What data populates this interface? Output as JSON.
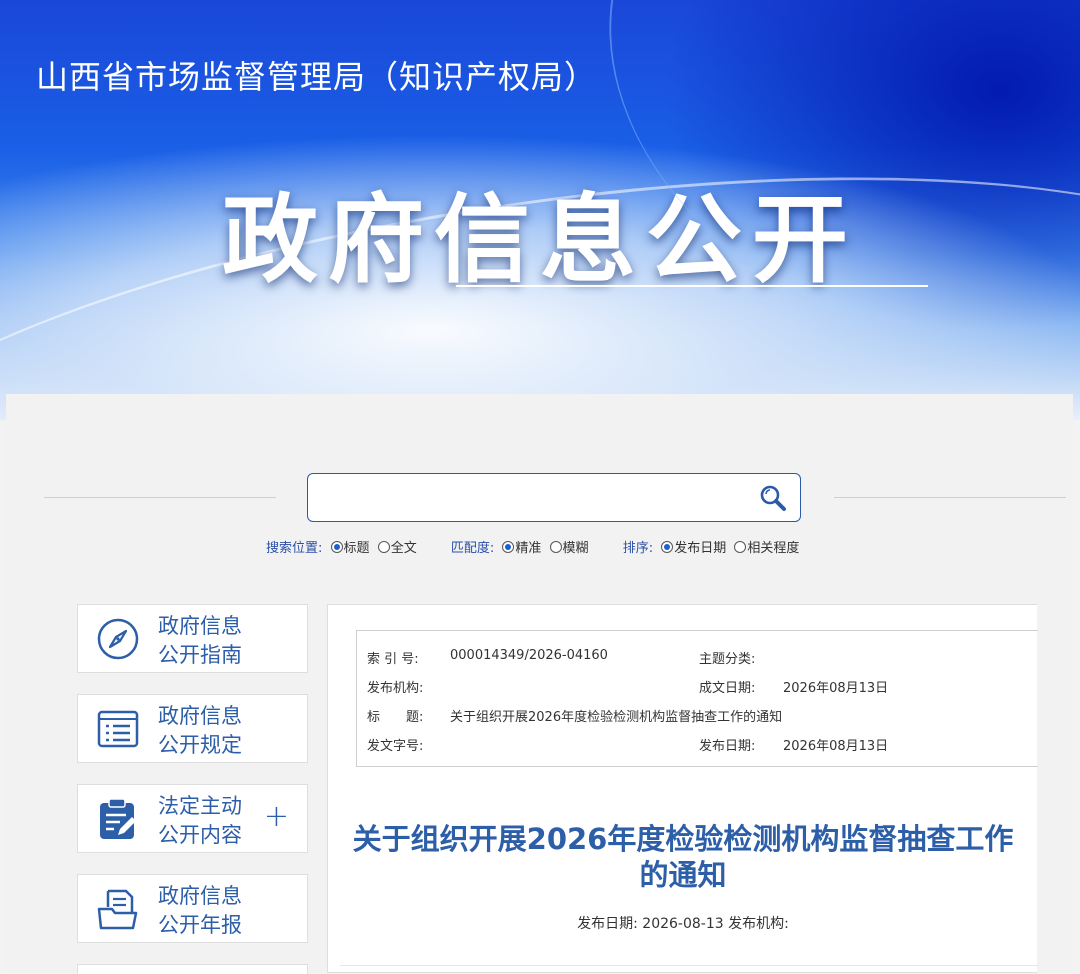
{
  "header": {
    "site_title": "山西省市场监督管理局（知识产权局）",
    "hero_title": "政府信息公开"
  },
  "search": {
    "value": "",
    "placeholder": "",
    "position_label": "搜索位置:",
    "position_options": [
      "标题",
      "全文"
    ],
    "match_label": "匹配度:",
    "match_options": [
      "精准",
      "模糊"
    ],
    "sort_label": "排序:",
    "sort_options": [
      "发布日期",
      "相关程度"
    ]
  },
  "sidebar": {
    "items": [
      {
        "line1": "政府信息",
        "line2": "公开指南",
        "icon": "compass-icon"
      },
      {
        "line1": "政府信息",
        "line2": "公开规定",
        "icon": "document-list-icon"
      },
      {
        "line1": "法定主动",
        "line2": "公开内容",
        "icon": "clipboard-edit-icon",
        "expand": "+"
      },
      {
        "line1": "政府信息",
        "line2": "公开年报",
        "icon": "folder-document-icon"
      }
    ]
  },
  "meta": {
    "index_label": "索 引 号:",
    "index_value": "000014349/2026-04160",
    "topic_label": "主题分类:",
    "topic_value": "",
    "publisher_label": "发布机构:",
    "publisher_value": "",
    "written_date_label": "成文日期:",
    "written_date_value": "2026年08月13日",
    "title_label": "标　　题:",
    "title_value": "关于组织开展2026年度检验检测机构监督抽查工作的通知",
    "doc_no_label": "发文字号:",
    "doc_no_value": "",
    "publish_date_label": "发布日期:",
    "publish_date_value": "2026年08月13日"
  },
  "article": {
    "title_line1": "关于组织开展2026年度检验检测机构监督抽查工作",
    "title_line2": "的通知",
    "date_line": "发布日期: 2026-08-13 发布机构:"
  }
}
